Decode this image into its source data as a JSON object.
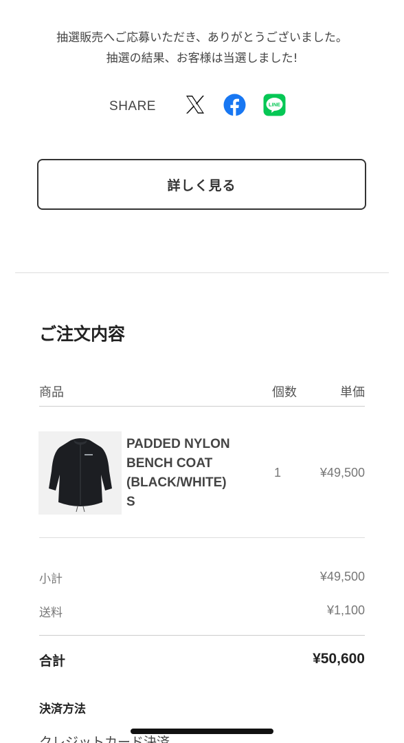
{
  "message": {
    "line1": "抽選販売へご応募いただき、ありがとうございました。",
    "line2": "抽選の結果、お客様は当選しました!"
  },
  "share": {
    "label": "SHARE",
    "icons": [
      "x-icon",
      "facebook-icon",
      "line-icon"
    ],
    "colors": {
      "x": "#111111",
      "facebook": "#1877F2",
      "line": "#06C755"
    }
  },
  "detail_button": {
    "label": "詳しく見る"
  },
  "order": {
    "title": "ご注文内容",
    "headers": {
      "product": "商品",
      "quantity": "個数",
      "unit_price": "単価"
    },
    "items": [
      {
        "name_lines": [
          "PADDED NYLON",
          "BENCH COAT",
          "(BLACK/WHITE)",
          "S"
        ],
        "quantity": "1",
        "price": "¥49,500"
      }
    ],
    "subtotal_label": "小計",
    "subtotal": "¥49,500",
    "shipping_label": "送料",
    "shipping": "¥1,100",
    "total_label": "合計",
    "total": "¥50,600"
  },
  "payment": {
    "title": "決済方法",
    "method": "クレジットカード決済"
  }
}
